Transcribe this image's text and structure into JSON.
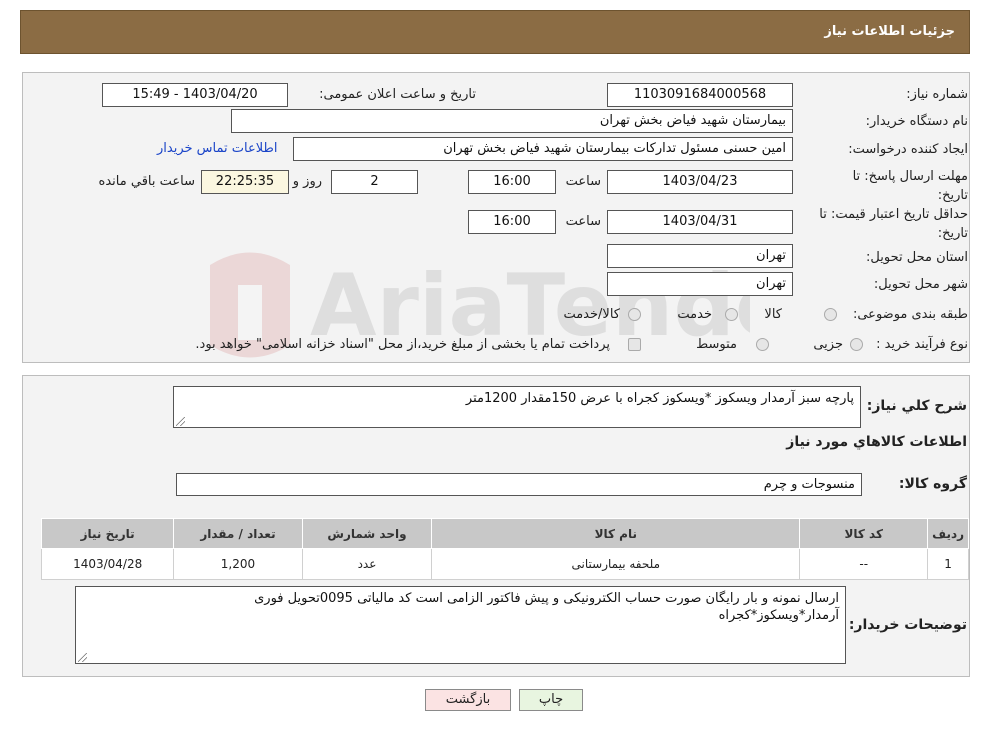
{
  "header": {
    "title": "جزئیات اطلاعات نیاز"
  },
  "fields": {
    "need_number_label": "شماره نیاز:",
    "need_number": "1103091684000568",
    "announce_label": "تاریخ و ساعت اعلان عمومی:",
    "announce_value": "1403/04/20 - 15:49",
    "buyer_org_label": "نام دستگاه خریدار:",
    "buyer_org": "بیمارستان شهید فیاض بخش تهران",
    "requester_label": "ایجاد کننده درخواست:",
    "requester": "امین حسنی مسئول تدارکات بیمارستان شهید فیاض بخش تهران",
    "contact_link": "اطلاعات تماس خریدار",
    "reply_deadline_label_1": "مهلت ارسال پاسخ: تا",
    "reply_deadline_label_2": "تاریخ:",
    "reply_date": "1403/04/23",
    "time_label": "ساعت",
    "reply_time": "16:00",
    "days_value": "2",
    "days_label": "روز و",
    "remaining_time": "22:25:35",
    "remaining_label": "ساعت باقي مانده",
    "price_validity_label_1": "حداقل تاریخ اعتبار قیمت: تا",
    "price_validity_label_2": "تاریخ:",
    "price_date": "1403/04/31",
    "price_time": "16:00",
    "province_label": "استان محل تحویل:",
    "province": "تهران",
    "city_label": "شهر محل تحویل:",
    "city": "تهران",
    "category_label": "طبقه بندی موضوعی:",
    "category_options": [
      "کالا",
      "خدمت",
      "کالا/خدمت"
    ],
    "purchase_type_label": "نوع فرآیند خرید :",
    "purchase_options": [
      "جزیی",
      "متوسط"
    ],
    "purchase_note": "پرداخت تمام یا بخشی از مبلغ خرید،از محل \"اسناد خزانه اسلامی\" خواهد بود."
  },
  "description": {
    "label": "شرح کلي نياز:",
    "text": "پارچه سبز آرمدار ویسکوز *ویسکوز  کجراه با عرض 150مقدار 1200متر"
  },
  "goods": {
    "section_title": "اطلاعات کالاهاي مورد نياز",
    "group_label": "گروه کالا:",
    "group_value": "منسوجات و چرم",
    "columns": [
      "رديف",
      "کد کالا",
      "نام کالا",
      "واحد شمارش",
      "تعداد / مقدار",
      "تاريخ نياز"
    ],
    "rows": [
      [
        "1",
        "--",
        "ملحفه بیمارستانی",
        "عدد",
        "1,200",
        "1403/04/28"
      ]
    ]
  },
  "buyer_notes": {
    "label": "توضیحات خریدار:",
    "line1": "ارسال نمونه و بار رایگان صورت حساب الکترونیکی و پیش فاکتور الزامی است کد مالیاتی 0095تحویل فوری",
    "line2": "آرمدار*ویسکوز*کجراه"
  },
  "buttons": {
    "print": "چاپ",
    "back": "بازگشت"
  },
  "colors": {
    "header_bg": "#8b6c44",
    "link": "#1a44c8",
    "back_button": "#fbe3e3",
    "print_button": "#e8f5e0"
  }
}
